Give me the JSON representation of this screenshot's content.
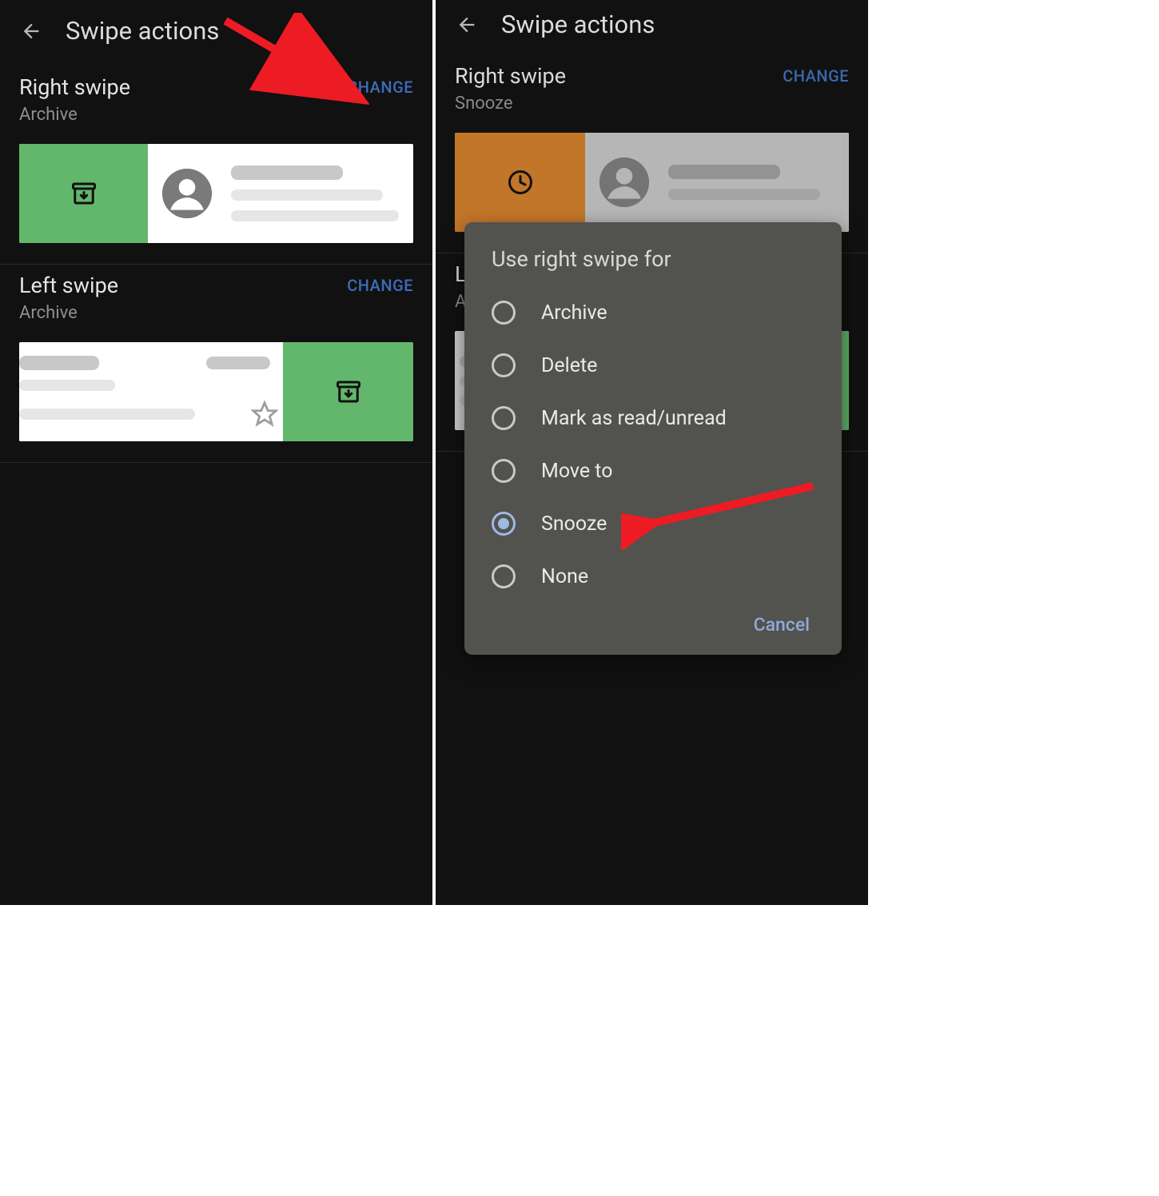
{
  "left_panel": {
    "title": "Swipe actions",
    "right_swipe": {
      "title": "Right swipe",
      "value": "Archive",
      "change": "CHANGE"
    },
    "left_swipe": {
      "title": "Left swipe",
      "value": "Archive",
      "change": "CHANGE"
    }
  },
  "right_panel": {
    "title": "Swipe actions",
    "right_swipe": {
      "title": "Right swipe",
      "value": "Snooze",
      "change": "CHANGE"
    },
    "left_swipe": {
      "title_initial": "L",
      "value_initial": "A"
    },
    "dialog": {
      "title": "Use right swipe for",
      "options": [
        {
          "label": "Archive",
          "selected": false
        },
        {
          "label": "Delete",
          "selected": false
        },
        {
          "label": "Mark as read/unread",
          "selected": false
        },
        {
          "label": "Move to",
          "selected": false
        },
        {
          "label": "Snooze",
          "selected": true
        },
        {
          "label": "None",
          "selected": false
        }
      ],
      "cancel": "Cancel"
    }
  }
}
